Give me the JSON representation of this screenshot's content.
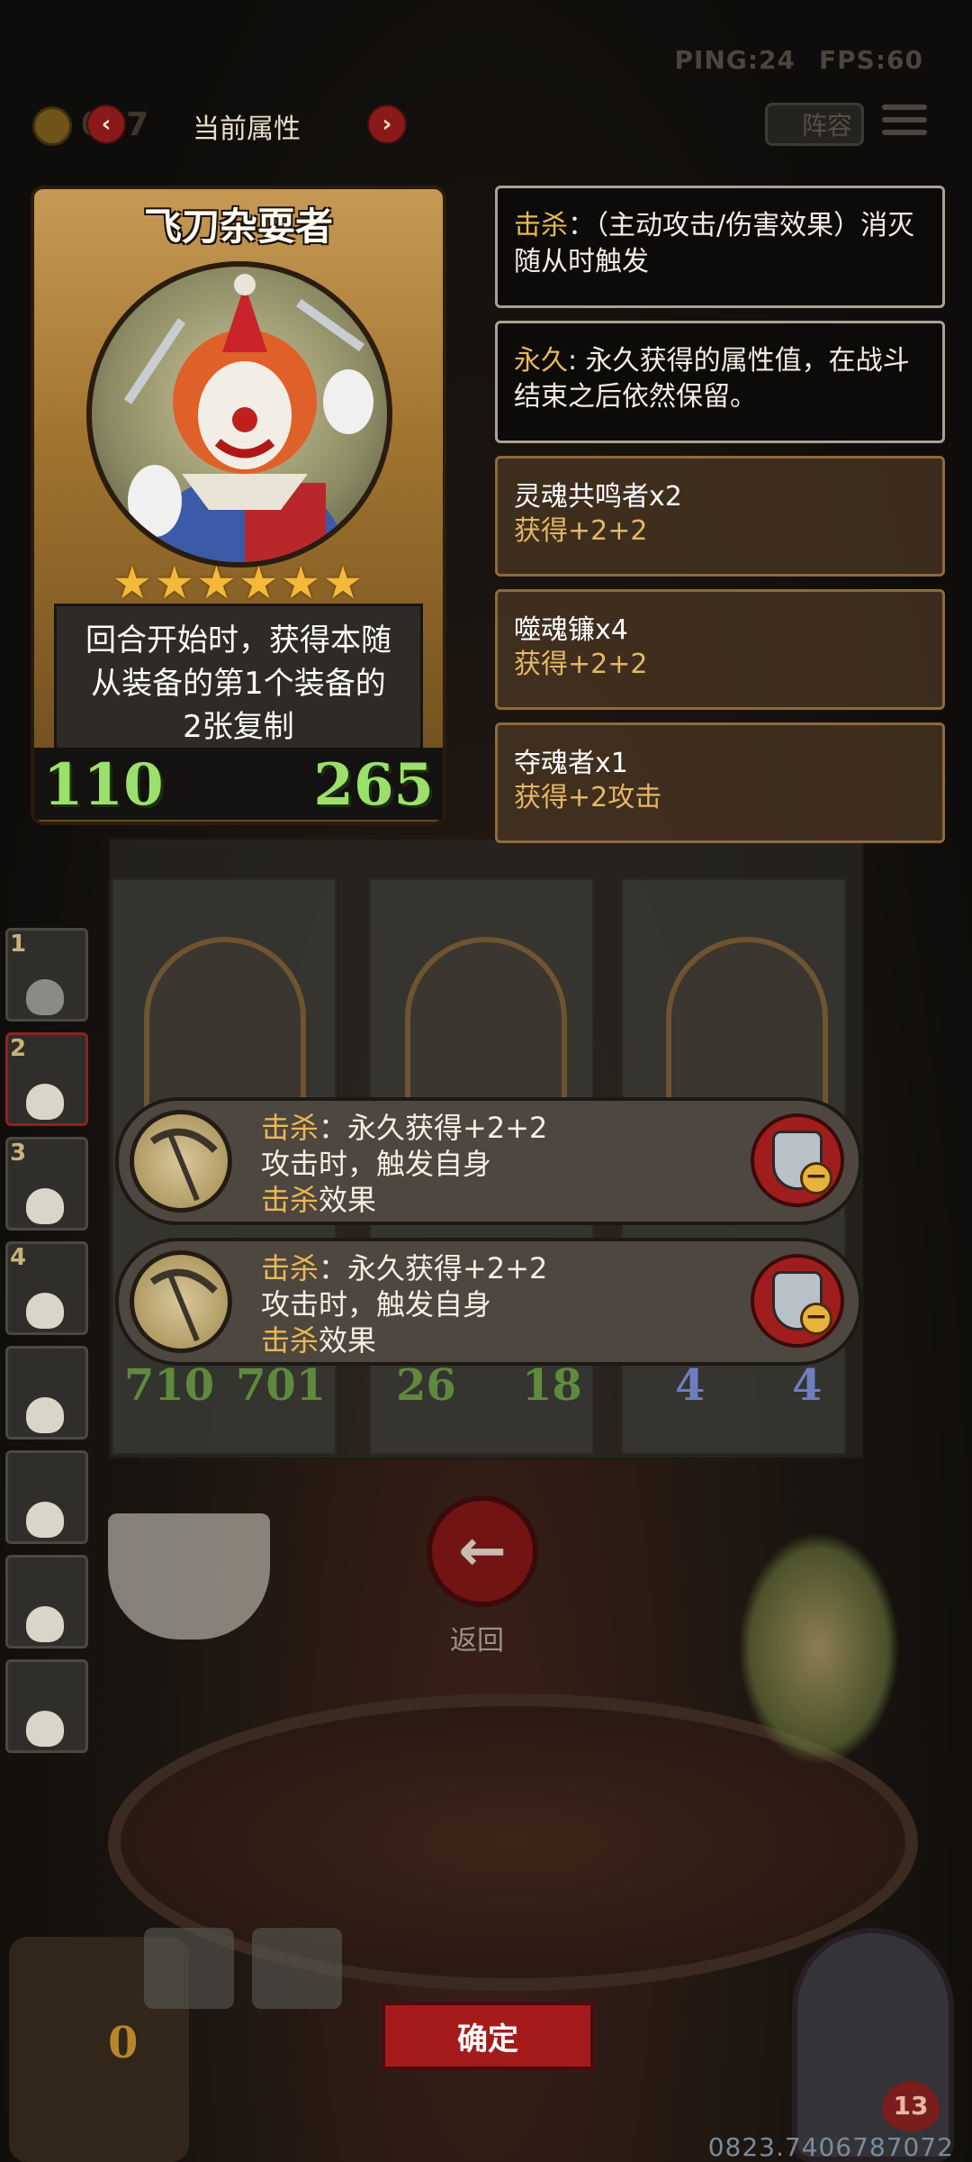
{
  "status": {
    "ping": "PING:24",
    "fps": "FPS:60"
  },
  "top_bar": {
    "coin_count": "017",
    "title": "当前属性",
    "prev_arrow": "‹",
    "next_arrow": "›",
    "lineup_label": "阵容"
  },
  "hero": {
    "name": "飞刀杂耍者",
    "stars": "★★★★★★",
    "star_count": 6,
    "description_lines": [
      "回合开始时，获得本随",
      "从装备的第1个装备的",
      "2张复制"
    ],
    "attack": "110",
    "health": "265"
  },
  "info": [
    {
      "keyword": "击杀",
      "text": "：（主动攻击/伤害效果）消灭随从时触发"
    },
    {
      "keyword": "永久",
      "text": ": 永久获得的属性值，在战斗结束之后依然保留。"
    }
  ],
  "combos": [
    {
      "name": "灵魂共鸣者x2",
      "effect": "获得+2+2"
    },
    {
      "name": "噬魂镰x4",
      "effect": "获得+2+2"
    },
    {
      "name": "夺魂者x1",
      "effect": "获得+2攻击"
    }
  ],
  "side_list": [
    "1",
    "2",
    "3",
    "4",
    "",
    "",
    "",
    ""
  ],
  "board_stats": [
    "710",
    "701",
    "26",
    "18",
    "4",
    "4"
  ],
  "equipment": [
    {
      "keyword": "击杀",
      "line1": "：永久获得+2+2",
      "line2": "攻击时，触发自身",
      "keyword2": "击杀",
      "line3": "效果"
    },
    {
      "keyword": "击杀",
      "line1": "：永久获得+2+2",
      "line2": "攻击时，触发自身",
      "keyword2": "击杀",
      "line3": "效果"
    }
  ],
  "return_label": "返回",
  "chest_count": "0",
  "boss_hp": "13",
  "confirm_label": "确定",
  "build_id": "0823.7406787072",
  "colors": {
    "accent_red": "#a51b1b",
    "keyword_gold": "#ebb854",
    "stat_green": "#9be06b"
  },
  "icons": [
    "coin-icon",
    "menu-icon",
    "star-icon",
    "scythe-icon",
    "shield-remove-icon",
    "back-arrow-icon",
    "skull-icon"
  ]
}
